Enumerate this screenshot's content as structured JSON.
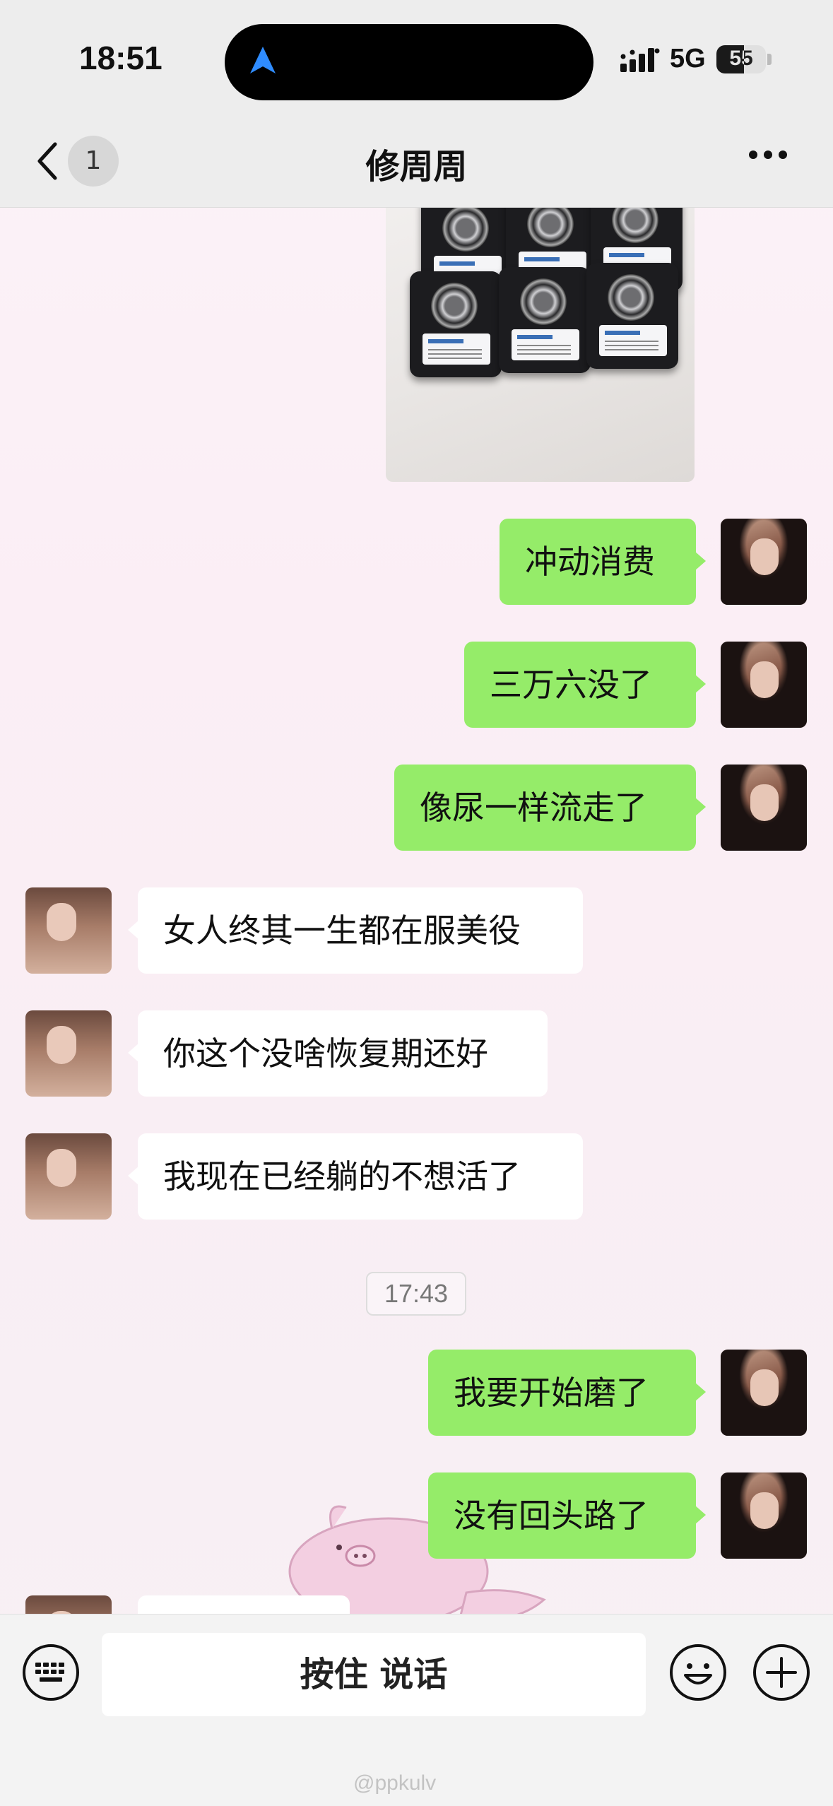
{
  "status_bar": {
    "time": "18:51",
    "network": "5G",
    "battery": "55",
    "battery_level": 0.55
  },
  "header": {
    "back_badge": "1",
    "title": "修周周",
    "back_icon": "chevron-left-icon",
    "more_icon": "more-dots-icon"
  },
  "messages": [
    {
      "side": "out",
      "type": "image"
    },
    {
      "side": "out",
      "text": "冲动消费"
    },
    {
      "side": "out",
      "text": "三万六没了"
    },
    {
      "side": "out",
      "text": "像尿一样流走了"
    },
    {
      "side": "in",
      "text": "女人终其一生都在服美役"
    },
    {
      "side": "in",
      "text": "你这个没啥恢复期还好"
    },
    {
      "side": "in",
      "text": "我现在已经躺的不想活了"
    },
    {
      "side": "out",
      "text": "我要开始磨了"
    },
    {
      "side": "out",
      "text": "没有回头路了"
    }
  ],
  "timestamp": "17:43",
  "input_bar": {
    "voice_label": "按住 说话",
    "keyboard_icon": "keyboard-icon",
    "emoji_icon": "emoji-icon",
    "plus_icon": "plus-icon"
  },
  "watermark": "@ppkulv",
  "colors": {
    "outgoing_bubble": "#95ec69",
    "incoming_bubble": "#ffffff",
    "header_bg": "#ededed"
  }
}
